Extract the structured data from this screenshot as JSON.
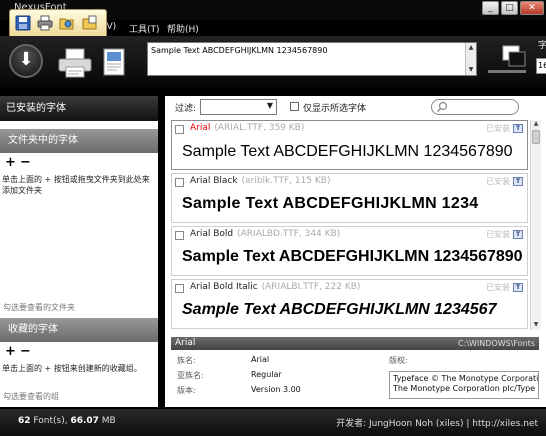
{
  "window": {
    "title": "NexusFont",
    "menu": [
      "(V)",
      "工具(T)",
      "帮助(H)"
    ],
    "controls": [
      "minimize",
      "maximize",
      "close"
    ]
  },
  "quick_toolbar": {
    "icons": [
      "save-icon",
      "print-icon",
      "open-folder-icon",
      "new-folder-icon"
    ]
  },
  "ribbon": {
    "sample_text": "Sample Text ABCDEFGHIJKLMN 1234567890",
    "size_label": "字",
    "size_value": "16"
  },
  "sidebar": {
    "installed_header": "已安装的字体",
    "folder_header": "文件夹中的字体",
    "folder_help": "单击上面的 + 按钮或拖曳文件夹到此处来添加文件夹",
    "folder_hint": "勾选要查看的文件夹",
    "favorites_header": "收藏的字体",
    "favorites_help": "单击上面的 + 按钮来创建新的收藏组。",
    "favorites_hint": "勾选要查看的组",
    "plus": "+",
    "minus": "−"
  },
  "filter": {
    "label": "过滤:",
    "select_value": "",
    "only_selected_label": "仅显示所选字体",
    "search_placeholder": ""
  },
  "fonts": [
    {
      "name": "Arial",
      "file": "(ARIAL.TTF, 359 KB)",
      "status": "已安装",
      "type_badge": "T",
      "sample": "Sample Text ABCDEFGHIJKLMN 1234567890",
      "selected": true
    },
    {
      "name": "Arial Black",
      "file": "(ariblk.TTF, 115 KB)",
      "status": "已安装",
      "type_badge": "T",
      "sample": "Sample Text ABCDEFGHIJKLMN 1234",
      "selected": false
    },
    {
      "name": "Arial Bold",
      "file": "(ARIALBD.TTF, 344 KB)",
      "status": "已安装",
      "type_badge": "T",
      "sample": "Sample Text ABCDEFGHIJKLMN 1234567890",
      "selected": false
    },
    {
      "name": "Arial Bold Italic",
      "file": "(ARIALBI.TTF, 222 KB)",
      "status": "已安装",
      "type_badge": "T",
      "sample": "Sample Text ABCDEFGHIJKLMN 1234567",
      "selected": false
    }
  ],
  "details": {
    "name": "Arial",
    "path": "C:\\WINDOWS\\Fonts",
    "family_label": "族名:",
    "family_value": "Arial",
    "subfamily_label": "亚族名:",
    "subfamily_value": "Regular",
    "version_label": "版本:",
    "version_value": "Version 3.00",
    "copyright_label": "版权:",
    "copyright_line1": "Typeface © The Monotype Corporati",
    "copyright_line2": "The Monotype Corporation plc/Type :"
  },
  "status": {
    "count": "62",
    "count_suffix": "Font(s),",
    "size": "66.07",
    "size_unit": "MB",
    "developer": "开发者: JungHoon Noh (xiles)",
    "website": "http://xiles.net"
  }
}
